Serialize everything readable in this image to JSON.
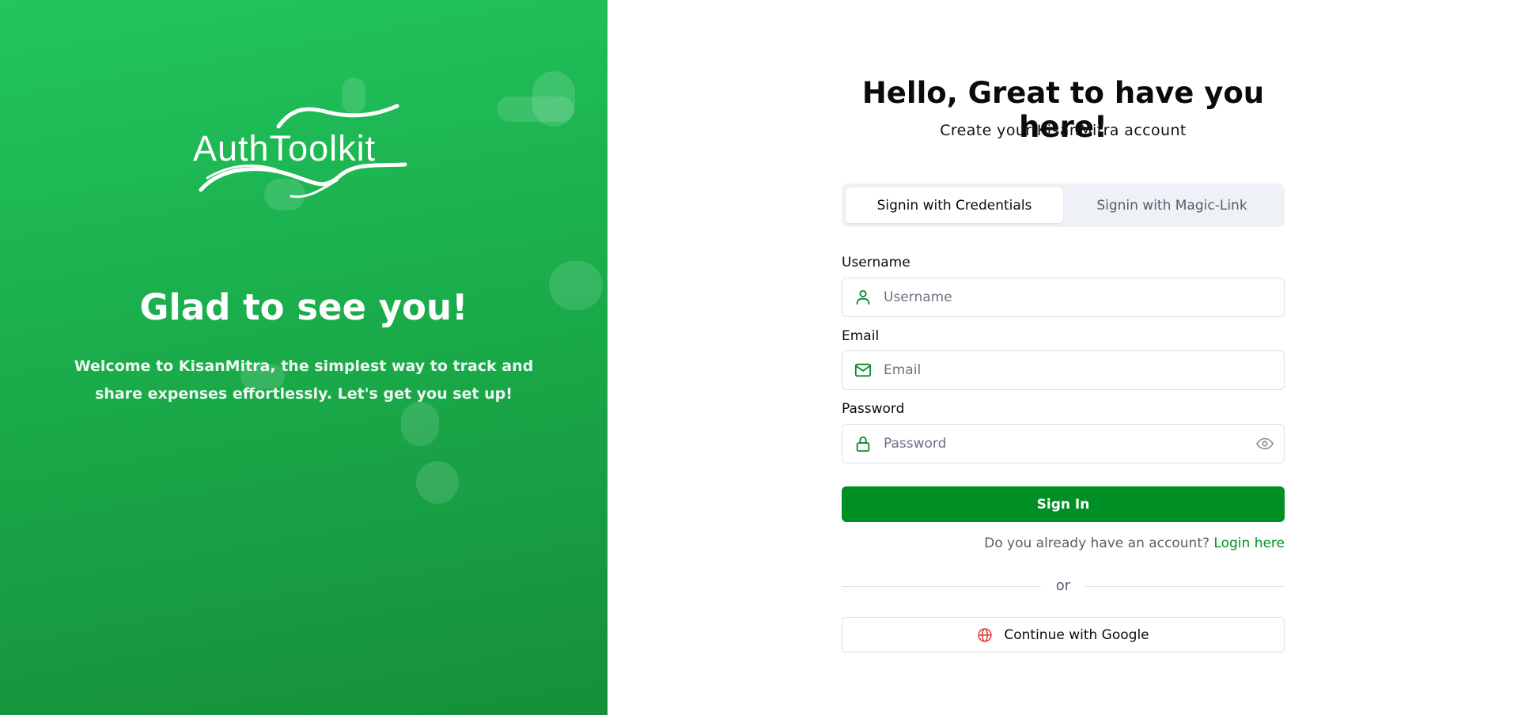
{
  "left_panel": {
    "logo_text": "AuthToolkit",
    "title": "Glad to see you!",
    "description": "Welcome to KisanMitra, the simplest way to track and share expenses effortlessly. Let's get you set up!",
    "gradient_colors": [
      "#22c55e",
      "#168f3a"
    ]
  },
  "form": {
    "heading": "Hello, Great to have you here!",
    "subheading": "Create your KisanMitra account",
    "tabs": [
      {
        "label": "Signin with Credentials",
        "active": true
      },
      {
        "label": "Signin with Magic-Link",
        "active": false
      }
    ],
    "username": {
      "label": "Username",
      "placeholder": "Username",
      "value": "",
      "icon": "user-icon"
    },
    "email": {
      "label": "Email",
      "placeholder": "Email",
      "value": "",
      "icon": "mail-icon"
    },
    "password": {
      "label": "Password",
      "placeholder": "Password",
      "value": "",
      "icon": "lock-icon",
      "toggle_icon": "eye-icon"
    },
    "submit_label": "Sign In",
    "account_prompt": "Do you already have an account?",
    "login_link": "Login here",
    "divider_text": "or",
    "google_label": "Continue with Google",
    "google_icon": "globe-icon"
  },
  "colors": {
    "accent": "#008f24",
    "icon_green": "#0a8a2a",
    "google_icon": "#e53935"
  }
}
